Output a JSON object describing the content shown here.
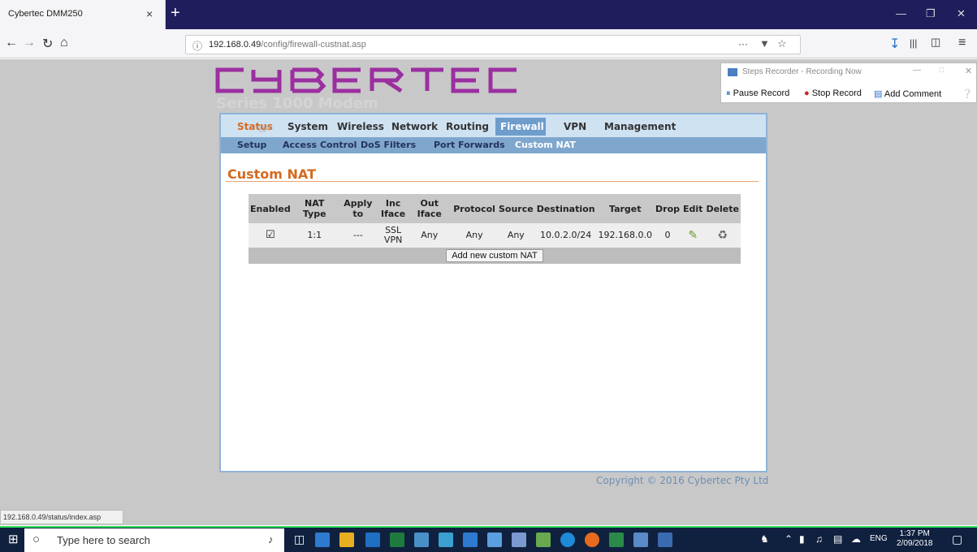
{
  "browser": {
    "tab_title": "Cybertec DMM250",
    "tab_close": "×",
    "new_tab": "+",
    "url_host": "192.168.0.49",
    "url_path": "/config/firewall-custnat.asp",
    "page_actions": "···"
  },
  "steps_recorder": {
    "title": "Steps Recorder - Recording Now",
    "pause": "Pause Record",
    "stop": "Stop Record",
    "comment": "Add Comment"
  },
  "brand": {
    "logo": "CYBERTEC",
    "subtitle": "Series 1000 Modem",
    "logo_color": "#9b2fa0"
  },
  "menu": {
    "main": [
      "Status",
      "System",
      "Wireless",
      "Network",
      "Routing",
      "Firewall",
      "VPN",
      "Management"
    ],
    "sub": [
      "Setup",
      "Access Control",
      "DoS Filters",
      "Port Forwards",
      "Custom NAT"
    ]
  },
  "section_title": "Custom NAT",
  "table": {
    "headers": [
      "Enabled",
      "NAT Type",
      "Apply to",
      "Inc Iface",
      "Out Iface",
      "Protocol",
      "Source",
      "Destination",
      "Target",
      "Drop",
      "Edit",
      "Delete"
    ],
    "row": {
      "enabled": "☑",
      "nat_type": "1:1",
      "apply_to": "---",
      "inc_iface": "SSL VPN",
      "out_iface": "Any",
      "protocol": "Any",
      "source": "Any",
      "destination": "10.0.2.0/24",
      "target": "192.168.0.0",
      "drop": "0"
    },
    "add_button": "Add new custom NAT"
  },
  "copyright": "Copyright © 2016 Cybertec Pty Ltd",
  "status_url": "192.168.0.49/status/index.asp",
  "taskbar": {
    "search_placeholder": "Type here to search",
    "time": "1:37 PM",
    "date": "2/09/2018",
    "lang": "ENG"
  },
  "colors": {
    "accent": "#d46a1e",
    "menu_bar": "#7fa7cd",
    "taskbar": "#10213f"
  }
}
